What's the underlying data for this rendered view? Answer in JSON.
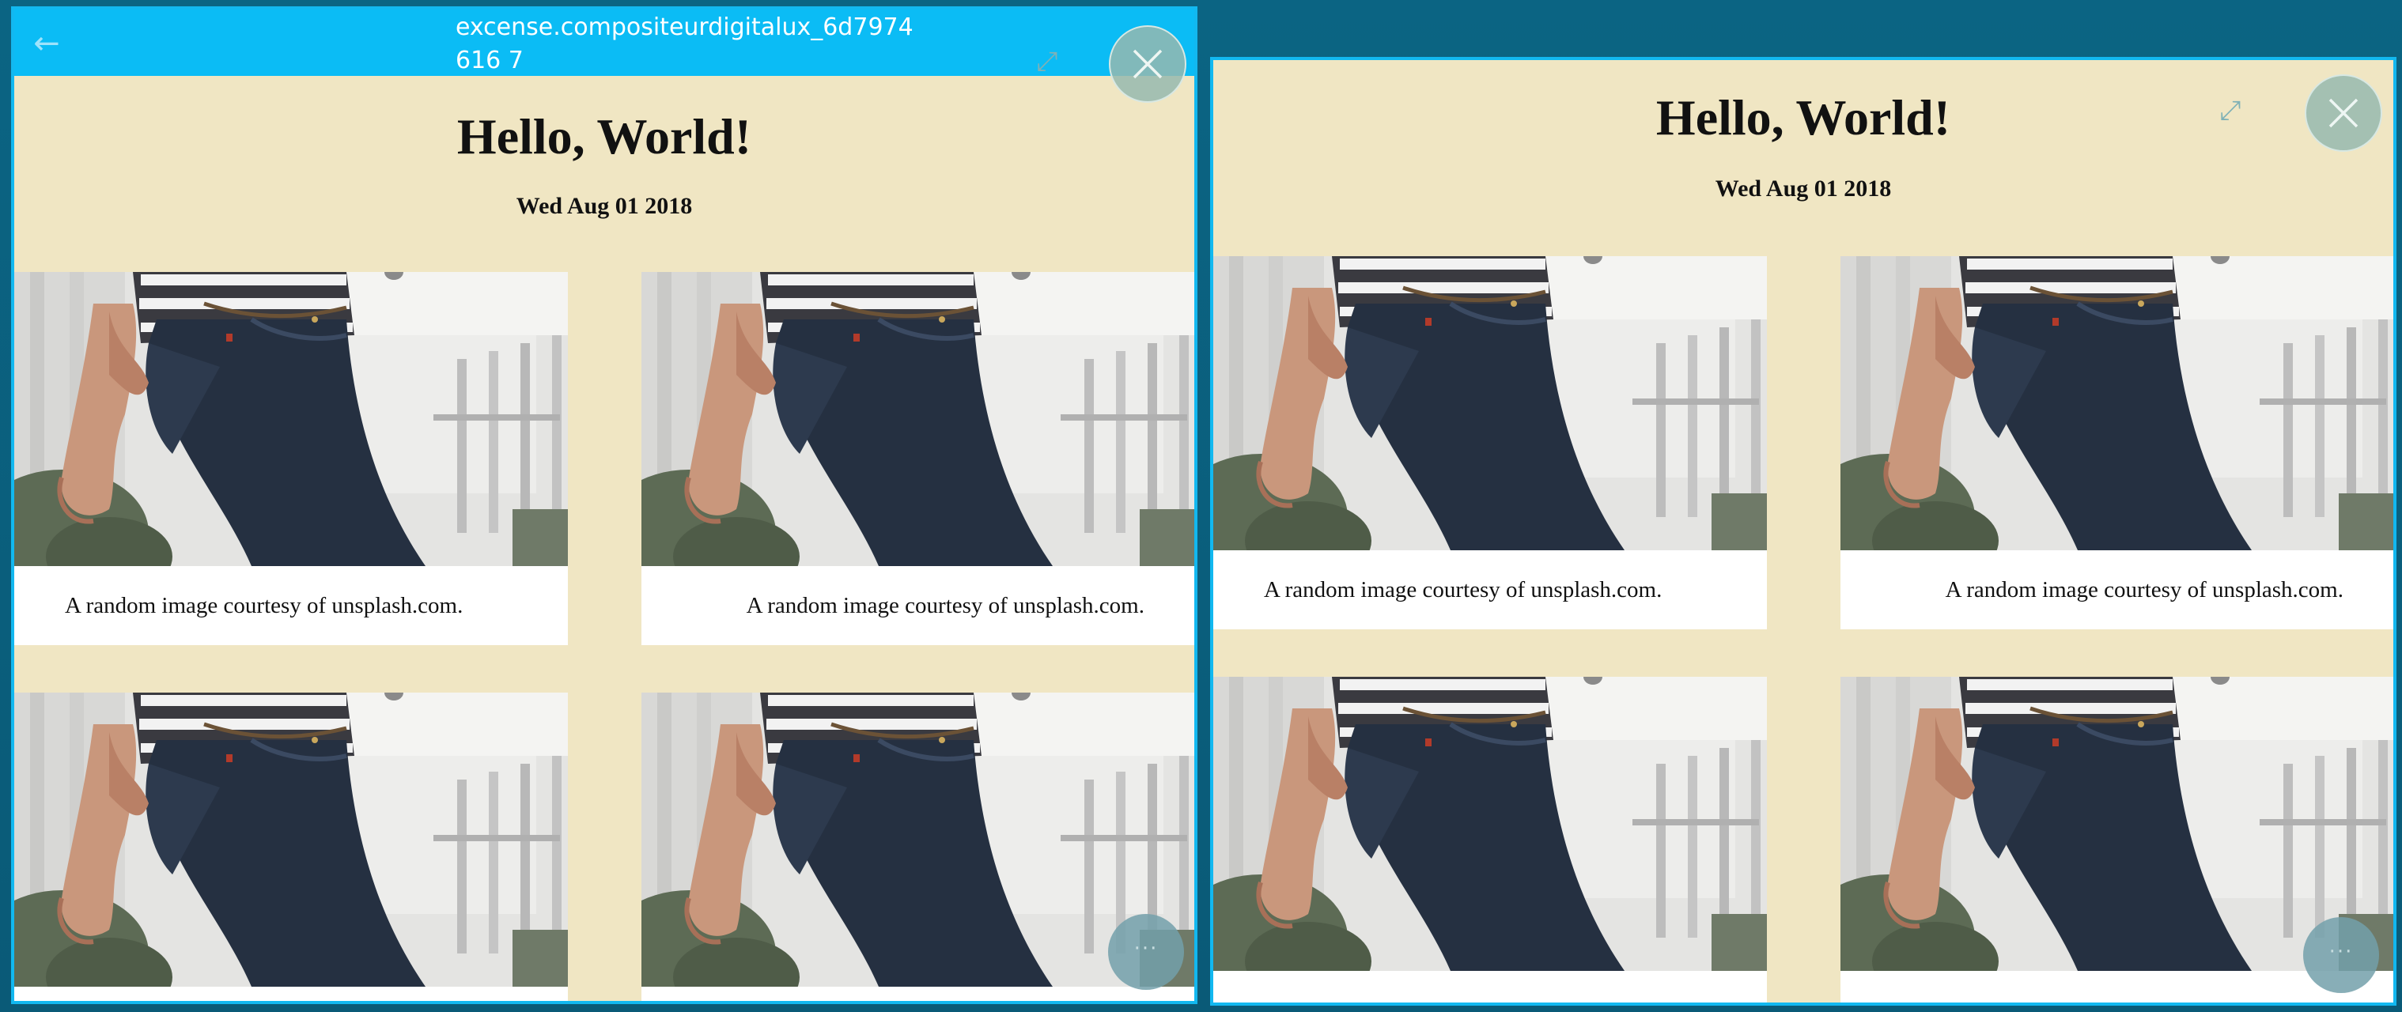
{
  "windows": [
    {
      "title": "excense.compositeurdigitalux_6d7974616 7",
      "page": {
        "heading": "Hello, World!",
        "date": "Wed Aug 01 2018"
      },
      "cards": [
        {
          "caption": "A random image courtesy of unsplash.com."
        },
        {
          "caption": "A random image courtesy of unsplash.com."
        }
      ]
    },
    {
      "page": {
        "heading": "Hello, World!",
        "date": "Wed Aug 01 2018"
      },
      "cards": [
        {
          "caption": "A random image courtesy of unsplash.com."
        },
        {
          "caption": "A random image courtesy of unsplash.com."
        }
      ]
    }
  ],
  "icons": {
    "back": "arrow-left-icon",
    "expand": "expand-icon",
    "close": "close-icon",
    "more": "more-icon"
  },
  "colors": {
    "titlebar": "#0bbcf5",
    "window_border": "#12b8f0",
    "page_background": "#f0e6c3",
    "desktop": "#0a5f7d"
  }
}
